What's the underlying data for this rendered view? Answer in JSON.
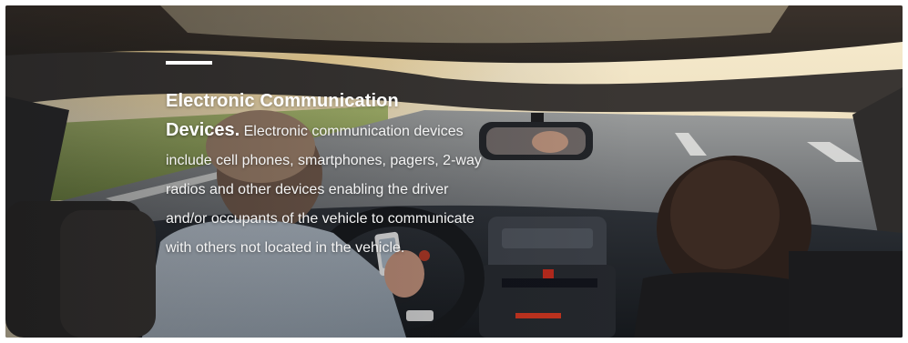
{
  "hero": {
    "heading_line1": "Electronic Communication",
    "heading_line2": "Devices.",
    "body": " Electronic communication devices include cell phones, smartphones, pagers, 2-way radios and other devices enabling the driver and/or occupants of the vehicle to communicate with others not located in the vehicle."
  },
  "colors": {
    "text": "#ffffff",
    "accent_bar": "#ffffff",
    "sky": "#f2e4c4",
    "road": "#6d7074",
    "cabin": "#24282e"
  }
}
